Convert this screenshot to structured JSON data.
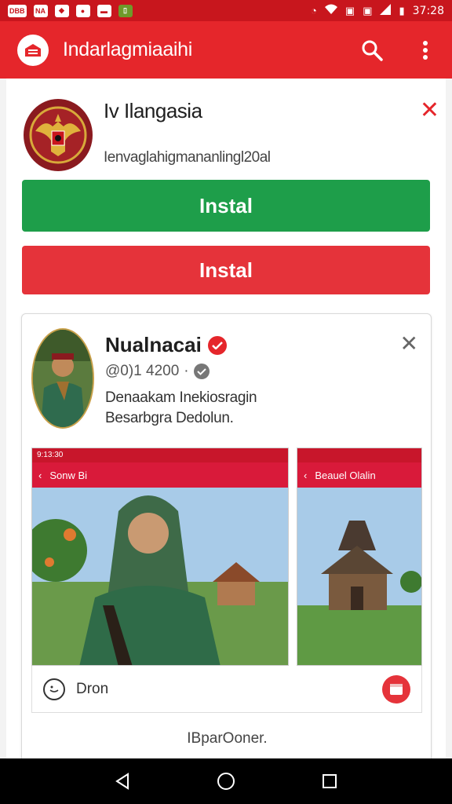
{
  "status_bar": {
    "left_items": [
      "DBB",
      "NA",
      "",
      "",
      "",
      ""
    ],
    "time": "37:28"
  },
  "app_bar": {
    "title": "Indarlagmiaaihi"
  },
  "promo": {
    "title": "Iv Ilangasia",
    "subtitle": "Ienvaglahigmananlingl20al",
    "install_primary": "Instal",
    "install_secondary": "Instal"
  },
  "post": {
    "name": "Nualnacai",
    "meta": "@0)1 4200",
    "description_line1": "Denaakam Inekiosragin",
    "description_line2": "Besarbgra Dedolun.",
    "shot1_status": "9:13:30",
    "shot1_bar": "Sonw Bi",
    "shot2_bar": "Beauel Olalin",
    "footer_label": "Dron",
    "bottom_text": "IBparOoner."
  },
  "colors": {
    "brand_red": "#e5262b",
    "install_green": "#1e9e4a",
    "install_red": "#e5333a"
  }
}
